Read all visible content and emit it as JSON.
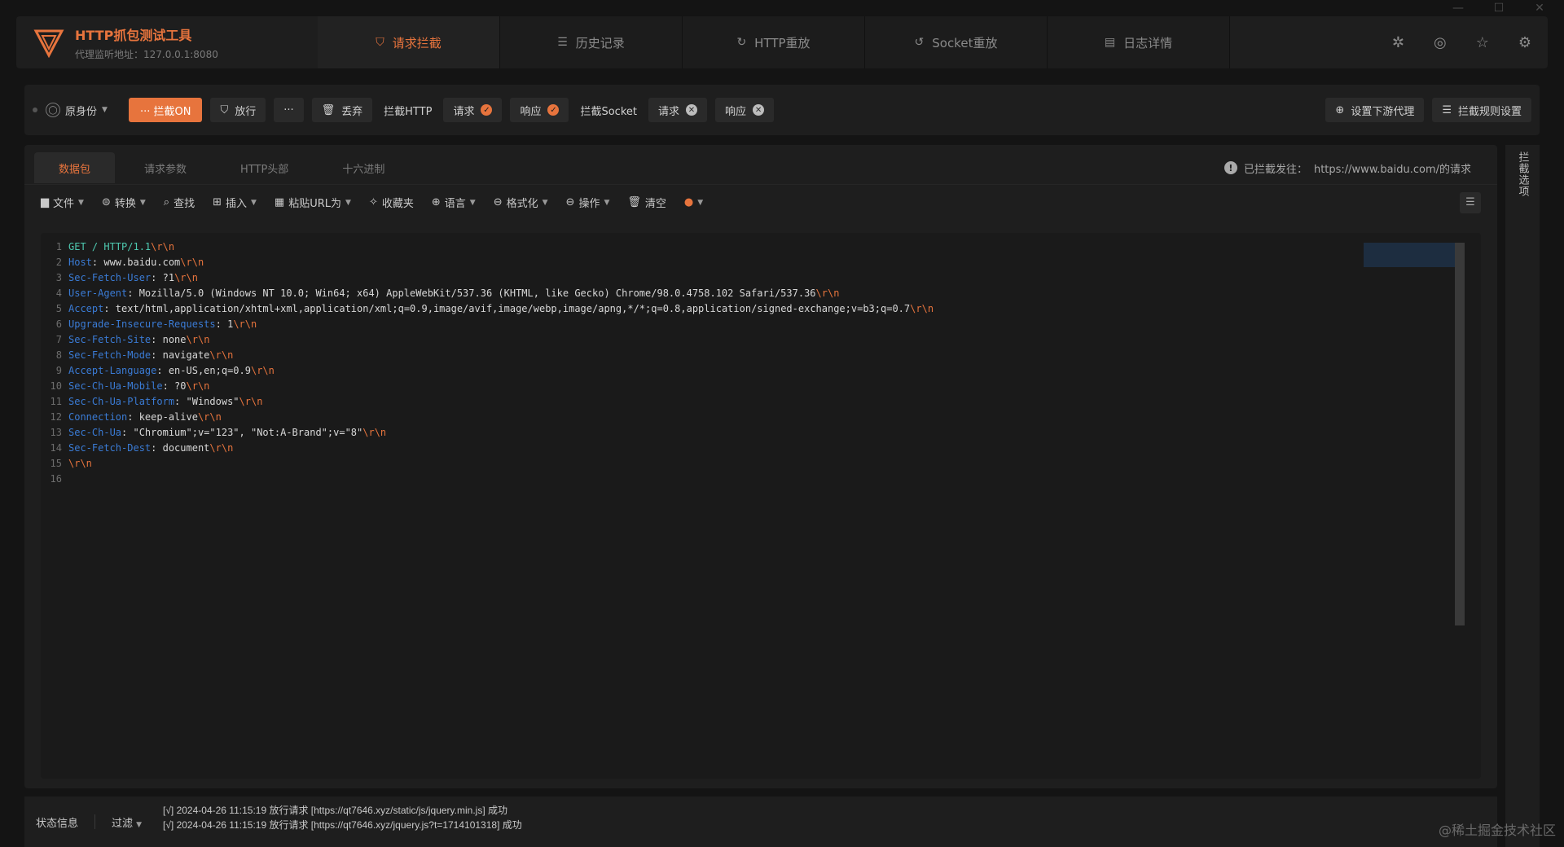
{
  "window_controls": [
    "—",
    "☐",
    "✕"
  ],
  "app": {
    "title": "HTTP抓包测试工具",
    "subtitle": "代理监听地址：127.0.0.1:8080"
  },
  "nav_tabs": [
    {
      "label": "请求拦截",
      "icon": "intercept-icon"
    },
    {
      "label": "历史记录",
      "icon": "history-icon"
    },
    {
      "label": "HTTP重放",
      "icon": "replay-icon"
    },
    {
      "label": "Socket重放",
      "icon": "socket-replay-icon"
    },
    {
      "label": "日志详情",
      "icon": "log-icon"
    }
  ],
  "toolbar": {
    "identity_label": "原身份",
    "intercept_on": "··· 拦截ON",
    "release": "放行",
    "more": "···",
    "discard": "丢弃",
    "intercept_http": "拦截HTTP",
    "http_request": "请求",
    "http_response": "响应",
    "intercept_socket": "拦截Socket",
    "socket_request": "请求",
    "socket_response": "响应",
    "downstream_proxy": "设置下游代理",
    "rule_settings": "拦截规则设置"
  },
  "sub_tabs": [
    "数据包",
    "请求参数",
    "HTTP头部",
    "十六进制"
  ],
  "intercept_info": {
    "label": "已拦截发往：",
    "target": "https://www.baidu.com/的请求"
  },
  "editor_tools": {
    "file": "文件",
    "convert": "转换",
    "find": "查找",
    "insert": "插入",
    "paste_url": "粘贴URL为",
    "favorites": "收藏夹",
    "language": "语言",
    "format": "格式化",
    "operation": "操作",
    "clear": "清空"
  },
  "code_lines": [
    {
      "n": "1",
      "k": "GET / HTTP/1.1",
      "v": ""
    },
    {
      "n": "2",
      "k": "Host",
      "v": ": www.baidu.com"
    },
    {
      "n": "3",
      "k": "Sec-Fetch-User",
      "v": ": ?1"
    },
    {
      "n": "4",
      "k": "User-Agent",
      "v": ": Mozilla/5.0 (Windows NT 10.0; Win64; x64) AppleWebKit/537.36 (KHTML, like Gecko) Chrome/98.0.4758.102 Safari/537.36"
    },
    {
      "n": "5",
      "k": "Accept",
      "v": ": text/html,application/xhtml+xml,application/xml;q=0.9,image/avif,image/webp,image/apng,*/*;q=0.8,application/signed-exchange;v=b3;q=0.7"
    },
    {
      "n": "6",
      "k": "Upgrade-Insecure-Requests",
      "v": ": 1"
    },
    {
      "n": "7",
      "k": "Sec-Fetch-Site",
      "v": ": none"
    },
    {
      "n": "8",
      "k": "Sec-Fetch-Mode",
      "v": ": navigate"
    },
    {
      "n": "9",
      "k": "Accept-Language",
      "v": ": en-US,en;q=0.9"
    },
    {
      "n": "10",
      "k": "Sec-Ch-Ua-Mobile",
      "v": ": ?0"
    },
    {
      "n": "11",
      "k": "Sec-Ch-Ua-Platform",
      "v": ": \"Windows\""
    },
    {
      "n": "12",
      "k": "Connection",
      "v": ": keep-alive"
    },
    {
      "n": "13",
      "k": "Sec-Ch-Ua",
      "v": ": \"Chromium\";v=\"123\", \"Not:A-Brand\";v=\"8\""
    },
    {
      "n": "14",
      "k": "Sec-Fetch-Dest",
      "v": ": document"
    },
    {
      "n": "15",
      "k": "",
      "v": ""
    },
    {
      "n": "16",
      "k": "",
      "v": ""
    }
  ],
  "crlf": "\\r\\n",
  "side_label": "拦截选项",
  "status": {
    "info": "状态信息",
    "filter": "过滤",
    "logs": [
      "[√] 2024-04-26 11:15:19 放行请求 [https://qt7646.xyz/static/js/jquery.min.js] 成功",
      "[√] 2024-04-26 11:15:19 放行请求 [https://qt7646.xyz/jquery.js?t=1714101318] 成功"
    ]
  },
  "watermark": "@稀土掘金技术社区",
  "colors": {
    "accent": "#e7743d",
    "key": "#3a7bd5",
    "method": "#4ec9b0"
  }
}
